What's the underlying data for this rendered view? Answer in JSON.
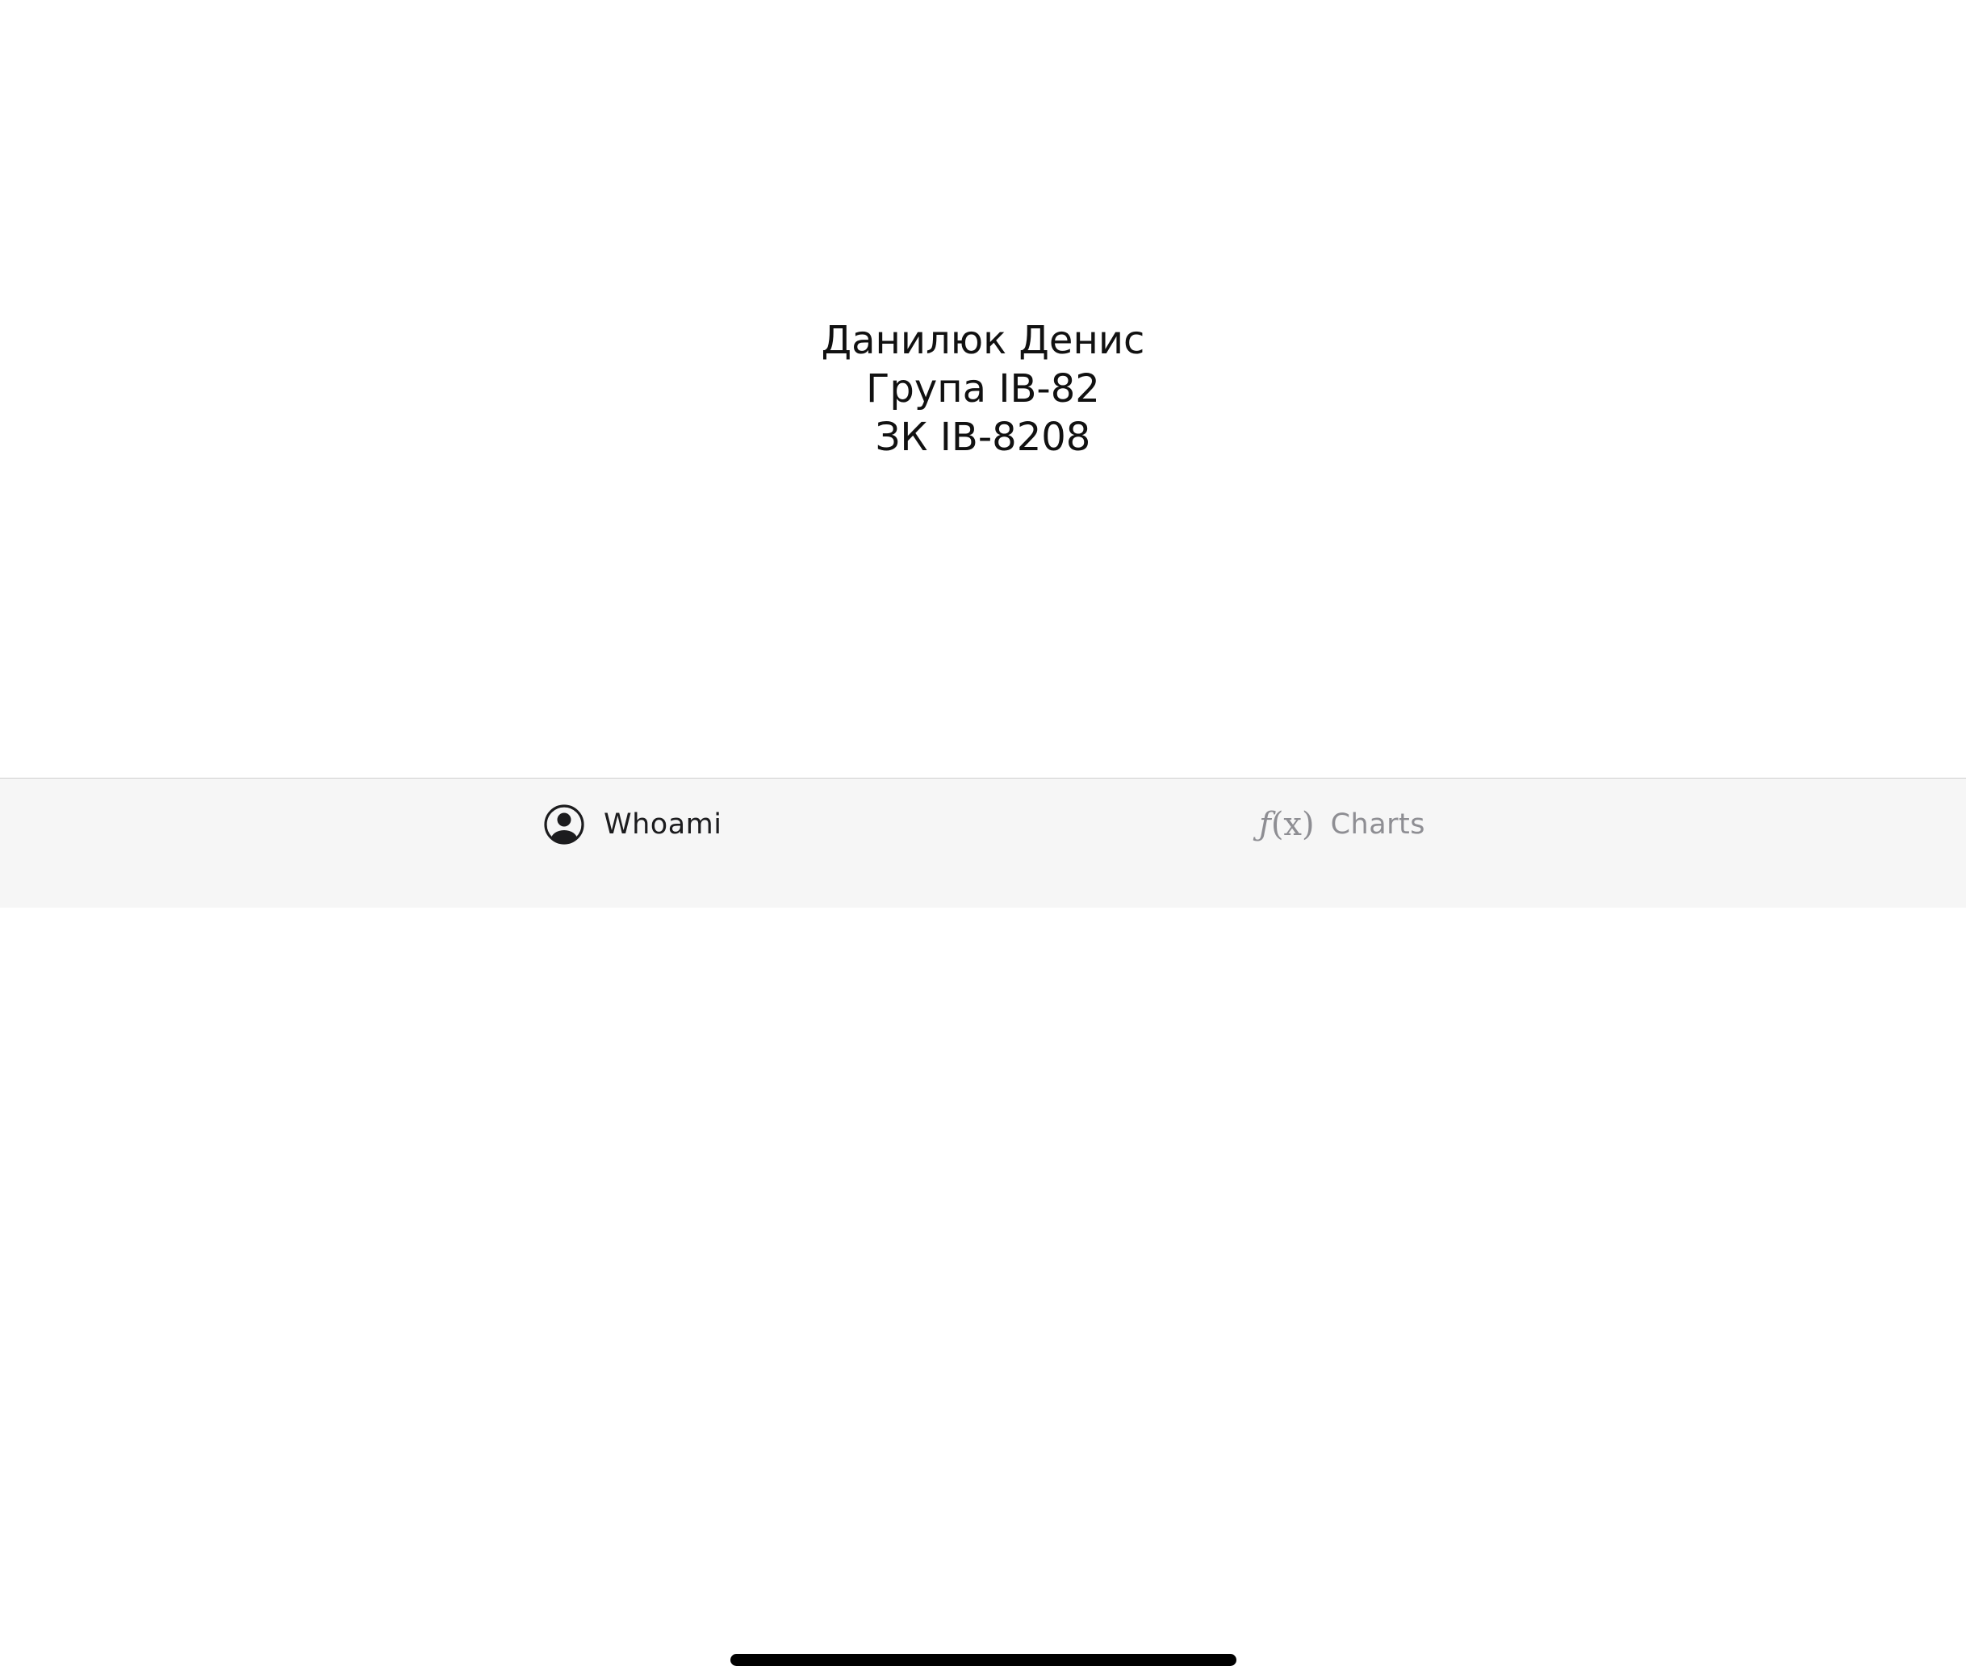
{
  "profile": {
    "name": "Данилюк Денис",
    "group": "Група ІВ-82",
    "record": "ЗК ІВ-8208"
  },
  "tabbar": {
    "tabs": [
      {
        "label": "Whoami",
        "icon": "person-circle-icon",
        "selected": true
      },
      {
        "label": "Charts",
        "icon": "function-fx-icon",
        "selected": false
      }
    ]
  },
  "colors": {
    "selected_tab": "#1c1c1e",
    "unselected_tab": "#8e8e93",
    "tabbar_background": "#f6f6f6"
  }
}
